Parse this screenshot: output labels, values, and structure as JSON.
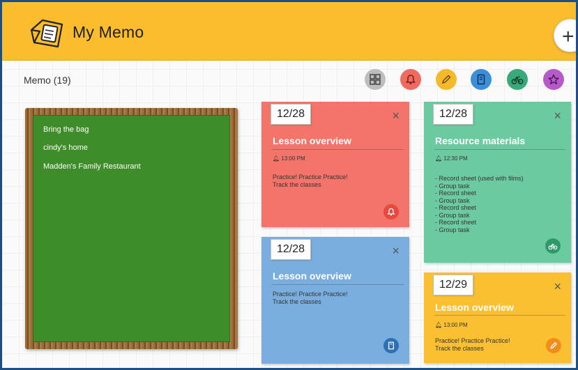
{
  "app": {
    "title": "My Memo"
  },
  "header": {
    "add_label": "+"
  },
  "memo_count": "Memo (19)",
  "filters": [
    {
      "name": "grid-icon",
      "color": "#bdbdbd"
    },
    {
      "name": "bell-icon",
      "color": "#ef6b61"
    },
    {
      "name": "pencil-icon",
      "color": "#f5b92c"
    },
    {
      "name": "book-icon",
      "color": "#3b8fd9"
    },
    {
      "name": "bicycle-icon",
      "color": "#3aa97a"
    },
    {
      "name": "star-icon",
      "color": "#b55ac8"
    }
  ],
  "board": {
    "lines": [
      "Bring the bag",
      "cindy's home",
      "Madden's Family Restaurant"
    ]
  },
  "notes": {
    "red": {
      "date": "12/28",
      "title": "Lesson overview",
      "time": "13:00 PM",
      "body": [
        "Practice! Practice Practice!",
        "Track the classes"
      ],
      "color": "#f2746a",
      "badge": "bell-icon"
    },
    "blue": {
      "date": "12/28",
      "title": "Lesson overview",
      "body": [
        "Practice! Practice Practice!",
        "Track the classes"
      ],
      "color": "#7aaedf",
      "badge": "book-icon"
    },
    "green": {
      "date": "12/28",
      "title": "Resource materials",
      "time": "12:30 PM",
      "body": [
        "- Record sheet (used with films)",
        "- Group task",
        "- Record sheet",
        "- Group task",
        "- Record sheet",
        "- Group task",
        "- Record sheet",
        "- Group task"
      ],
      "color": "#6ccaa0",
      "badge": "bicycle-icon"
    },
    "yellow": {
      "date": "12/29",
      "title": "Lesson overview",
      "time": "13:00 PM",
      "body": [
        "Practice! Practice Practice!",
        "Track the classes"
      ],
      "color": "#fbc032",
      "badge": "pencil-icon"
    }
  },
  "close_label": "×"
}
